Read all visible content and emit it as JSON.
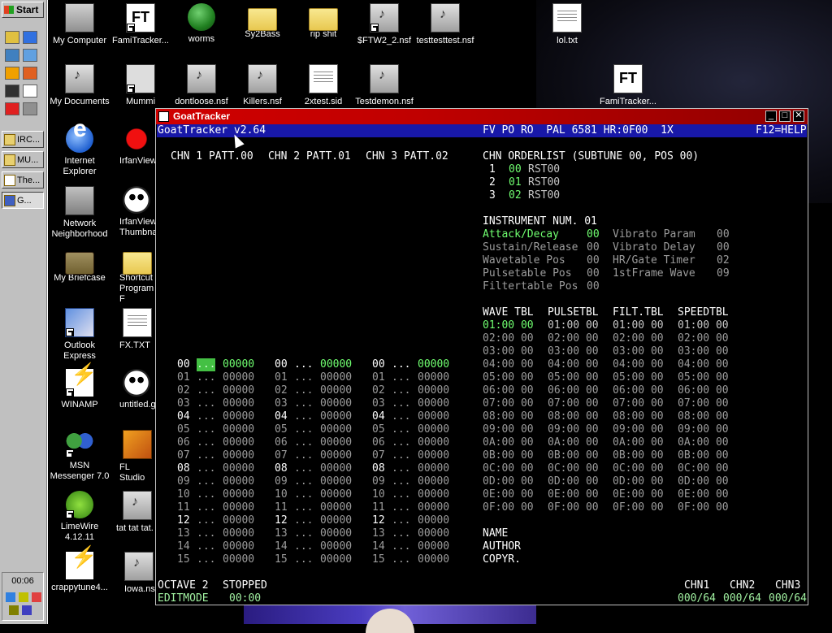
{
  "desktop": {
    "icons": [
      {
        "label": "My Computer",
        "icon": "computer-icon"
      },
      {
        "label": "FamiTracker...",
        "icon": "famitracker-icon"
      },
      {
        "label": "worms",
        "icon": "globe-icon"
      },
      {
        "label": "Sy2Bass",
        "icon": "folder-icon"
      },
      {
        "label": "rip shit",
        "icon": "folder-icon"
      },
      {
        "label": "$FTW2_2.nsf",
        "icon": "nsf-icon"
      },
      {
        "label": "testtesttest.nsf",
        "icon": "nsf-icon"
      },
      {
        "label": "lol.txt",
        "icon": "text-file-icon"
      },
      {
        "label": "My Documents",
        "icon": "documents-icon"
      },
      {
        "label": "Mummi",
        "icon": "program-icon"
      },
      {
        "label": "dontloose.nsf",
        "icon": "nsf-icon"
      },
      {
        "label": "Killers.nsf",
        "icon": "nsf-icon"
      },
      {
        "label": "2xtest.sid",
        "icon": "sid-icon"
      },
      {
        "label": "Testdemon.nsf",
        "icon": "nsf-icon"
      },
      {
        "label": "FamiTracker...",
        "icon": "famitracker-icon"
      },
      {
        "label": "Internet Explorer",
        "icon": "ie-icon"
      },
      {
        "label": "IrfanView",
        "icon": "irfanview-icon"
      },
      {
        "label": "Network Neighborhood",
        "icon": "network-icon"
      },
      {
        "label": "IrfanView Thumbnai",
        "icon": "panda-icon"
      },
      {
        "label": "My Briefcase",
        "icon": "briefcase-icon"
      },
      {
        "label": "Shortcut Program F",
        "icon": "folder-icon"
      },
      {
        "label": "Outlook Express",
        "icon": "outlook-icon"
      },
      {
        "label": "FX.TXT",
        "icon": "text-file-icon"
      },
      {
        "label": "WINAMP",
        "icon": "winamp-icon"
      },
      {
        "label": "untitled.g",
        "icon": "panda-icon"
      },
      {
        "label": "MSN Messenger 7.0",
        "icon": "msn-icon"
      },
      {
        "label": "FL Studio",
        "icon": "flstudio-icon"
      },
      {
        "label": "LimeWire 4.12.11",
        "icon": "limewire-icon"
      },
      {
        "label": "tat tat tat.",
        "icon": "nsf-icon"
      },
      {
        "label": "crappytune4...",
        "icon": "winamp-icon"
      },
      {
        "label": "Iowa.nsi",
        "icon": "nsf-icon"
      }
    ]
  },
  "taskbar": {
    "start_label": "Start",
    "buttons": [
      "IRC...",
      "MU...",
      "The...",
      "G..."
    ],
    "clock": "00:06"
  },
  "window": {
    "title": "GoatTracker"
  },
  "goat": {
    "header_left": "GoatTracker v2.64",
    "header_mid": "FV PO RO  PAL 6581 HR:0F00  1X",
    "header_right": "F12=HELP",
    "chn_headers": [
      "CHN 1 PATT.00",
      "CHN 2 PATT.01",
      "CHN 3 PATT.02"
    ],
    "orderlist_title": "CHN ORDERLIST (SUBTUNE 00, POS 00)",
    "orderlist": [
      {
        "chn": "1",
        "pos": "00",
        "cmd": "RST00"
      },
      {
        "chn": "2",
        "pos": "01",
        "cmd": "RST00"
      },
      {
        "chn": "3",
        "pos": "02",
        "cmd": "RST00"
      }
    ],
    "instrument_title": "INSTRUMENT NUM. 01",
    "instr_left": [
      {
        "label": "Attack/Decay",
        "value": "00"
      },
      {
        "label": "Sustain/Release",
        "value": "00"
      },
      {
        "label": "Wavetable Pos",
        "value": "00"
      },
      {
        "label": "Pulsetable Pos",
        "value": "00"
      },
      {
        "label": "Filtertable Pos",
        "value": "00"
      }
    ],
    "instr_right": [
      {
        "label": "Vibrato Param",
        "value": "00"
      },
      {
        "label": "Vibrato Delay",
        "value": "00"
      },
      {
        "label": "HR/Gate Timer",
        "value": "02"
      },
      {
        "label": "1stFrame Wave",
        "value": "09"
      }
    ],
    "table_headers": [
      "WAVE TBL",
      "PULSETBL",
      "FILT.TBL",
      "SPEEDTBL"
    ],
    "table_rows": [
      "01:00 00",
      "02:00 00",
      "03:00 00",
      "04:00 00",
      "05:00 00",
      "06:00 00",
      "07:00 00",
      "08:00 00",
      "09:00 00",
      "0A:00 00",
      "0B:00 00",
      "0C:00 00",
      "0D:00 00",
      "0E:00 00",
      "0F:00 00"
    ],
    "pattern_rows": [
      "00",
      "01",
      "02",
      "03",
      "04",
      "05",
      "06",
      "07",
      "08",
      "09",
      "10",
      "11",
      "12",
      "13",
      "14",
      "15"
    ],
    "pattern_note": "...",
    "pattern_data": "00000",
    "info_labels": [
      "NAME",
      "AUTHOR",
      "COPYR."
    ],
    "octave": "OCTAVE 2",
    "status": "STOPPED",
    "editmode": "EDITMODE",
    "time": "00:00",
    "chn_status_headers": [
      "CHN1",
      "CHN2",
      "CHN3"
    ],
    "chn_status_values": [
      "000/64",
      "000/64",
      "000/64"
    ]
  },
  "colors": {
    "header_bg": "#1818a8",
    "titlebar": "#c00000",
    "highlight_green": "#70ff70",
    "cursor_green": "#44c044"
  }
}
